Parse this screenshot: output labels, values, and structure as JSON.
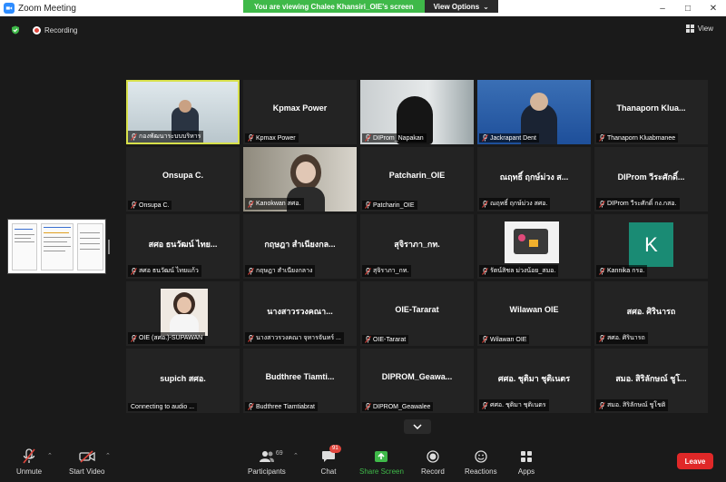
{
  "window": {
    "title": "Zoom Meeting"
  },
  "share_banner": {
    "viewing": "You are viewing Chalee Khansiri_OIE's screen",
    "view_options": "View Options"
  },
  "top": {
    "recording": "Recording",
    "view": "View"
  },
  "colors": {
    "active_speaker": "#d7e04a",
    "share_green": "#3fb949",
    "leave_red": "#e02828",
    "record_red": "#e0463d"
  },
  "tiles": [
    {
      "display": "",
      "name": "กองพัฒนาระบบบริหาร"
    },
    {
      "display": "Kpmax Power",
      "name": "Kpmax Power"
    },
    {
      "display": "",
      "name": "DIProm_Napakan"
    },
    {
      "display": "",
      "name": "Jackrapant Dent"
    },
    {
      "display": "Thanaporn  Klua...",
      "name": "Thanaporn Kluabmanee"
    },
    {
      "display": "Onsupa C.",
      "name": "Onsupa C."
    },
    {
      "display": "",
      "name": "Kanokwan สศอ."
    },
    {
      "display": "Patcharin_OIE",
      "name": "Patcharin_OIE"
    },
    {
      "display": "ณฤทธิ์ ฤกษ์ม่วง ส...",
      "name": "ณฤทธิ์ ฤกษ์ม่วง สศอ."
    },
    {
      "display": "DIProm วีระศักดิ์...",
      "name": "DIProm วีระศักดิ์ กง.กสอ."
    },
    {
      "display": "สศอ ธนวัฒน์ ไทย...",
      "name": "สศอ ธนวัฒน์ ไทยแก้ว"
    },
    {
      "display": "กฤษฎา สำเนียงกล...",
      "name": "กฤษฎา สำเนียงกลาง"
    },
    {
      "display": "สุจิราภา_กท.",
      "name": "สุจิราภา_กท."
    },
    {
      "display": "",
      "name": "รัตน์สิชล ม่วงน้อย_สมอ."
    },
    {
      "display": "",
      "name": "Kannika กรอ."
    },
    {
      "display": "",
      "name": "OIE (สศอ.)-SUPAWAN"
    },
    {
      "display": "นางสาวรวงคณา...",
      "name": "นางสาวรวงคณา  จุหารจันทร์ ..."
    },
    {
      "display": "OIE-Tararat",
      "name": "OIE-Tararat"
    },
    {
      "display": "Wilawan OIE",
      "name": "Wilawan OIE"
    },
    {
      "display": "สศอ. ศิรินารถ",
      "name": "สศอ. ศิรินารถ"
    },
    {
      "display": "supich สศอ.",
      "name": "Connecting to audio ..."
    },
    {
      "display": "Budthree  Tiamti...",
      "name": "Budthree Tiamtiabrat"
    },
    {
      "display": "DIPROM_Geawa...",
      "name": "DIPROM_Geawalee"
    },
    {
      "display": "ศศอ. ชุติมา ชุติเนตร",
      "name": "ศศอ. ชุติมา ชุติเนตร"
    },
    {
      "display": "สมอ. สิริลักษณ์ ชูโ...",
      "name": "สมอ. สิริลักษณ์ ชูโชติ"
    }
  ],
  "kannika_avatar": {
    "letter": "K",
    "color": "#1a8b74"
  },
  "toolbar": {
    "unmute": "Unmute",
    "start_video": "Start Video",
    "participants": "Participants",
    "participants_count": "69",
    "chat": "Chat",
    "chat_badge": "91",
    "share_screen": "Share Screen",
    "record": "Record",
    "reactions": "Reactions",
    "apps": "Apps",
    "leave": "Leave"
  }
}
